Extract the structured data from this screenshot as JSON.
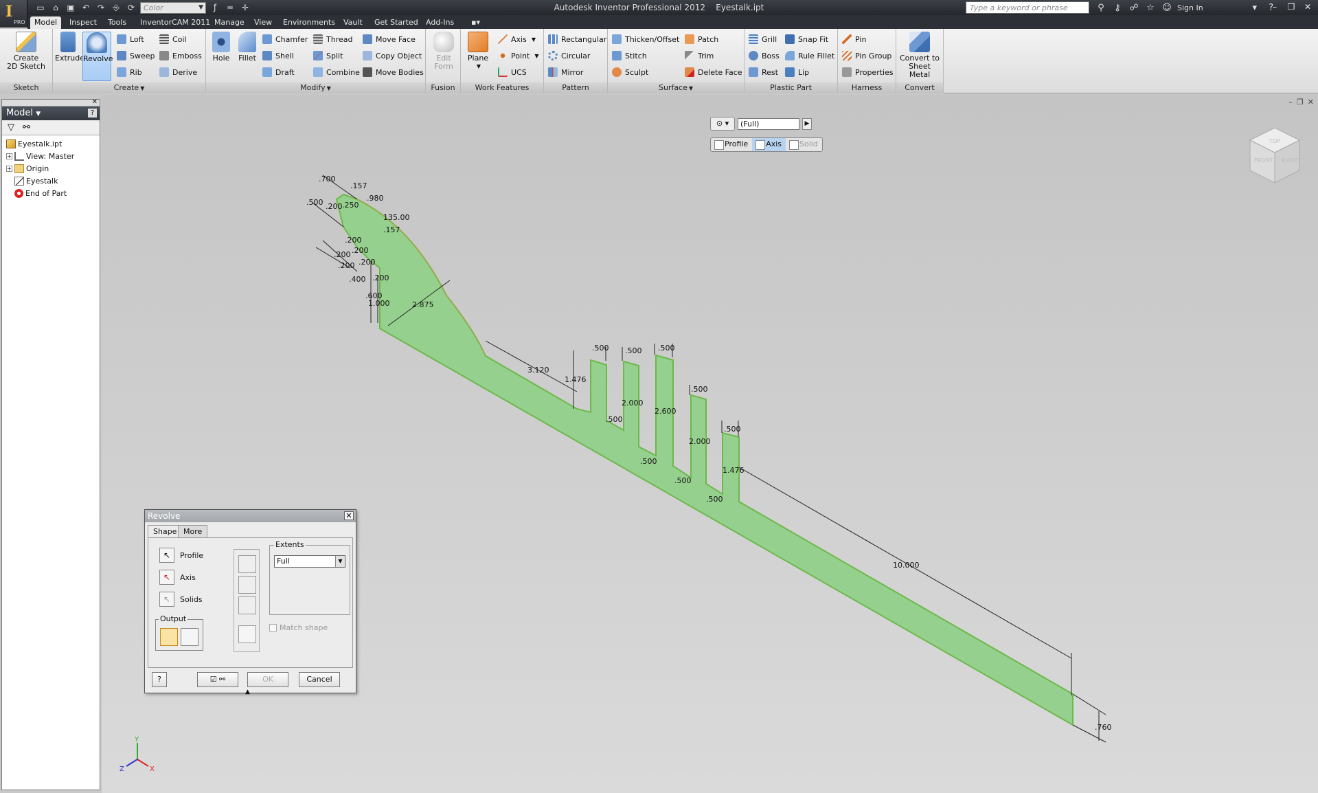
{
  "app": {
    "title": "Autodesk Inventor Professional 2012",
    "file": "Eyestalk.ipt",
    "logo_text": "I",
    "edition": "PRO",
    "color_combo": "Color",
    "search_placeholder": "Type a keyword or phrase",
    "sign_in": "Sign In"
  },
  "menu_tabs": [
    "Model",
    "Inspect",
    "Tools",
    "InventorCAM 2011",
    "Manage",
    "View",
    "Environments",
    "Vault",
    "Get Started",
    "Add-Ins"
  ],
  "ribbon": {
    "sketch": {
      "title": "Sketch",
      "create_sketch_l1": "Create",
      "create_sketch_l2": "2D Sketch"
    },
    "create": {
      "title": "Create",
      "extrude": "Extrude",
      "revolve": "Revolve",
      "loft": "Loft",
      "sweep": "Sweep",
      "rib": "Rib",
      "coil": "Coil",
      "emboss": "Emboss",
      "derive": "Derive"
    },
    "modify": {
      "title": "Modify",
      "hole": "Hole",
      "fillet": "Fillet",
      "chamfer": "Chamfer",
      "shell": "Shell",
      "draft": "Draft",
      "thread": "Thread",
      "split": "Split",
      "combine": "Combine",
      "move_face": "Move Face",
      "copy_object": "Copy Object",
      "move_bodies": "Move Bodies"
    },
    "fusion": {
      "title": "Fusion",
      "edit_form_l1": "Edit",
      "edit_form_l2": "Form"
    },
    "work_features": {
      "title": "Work Features",
      "plane": "Plane",
      "axis": "Axis",
      "point": "Point",
      "ucs": "UCS"
    },
    "pattern": {
      "title": "Pattern",
      "rectangular": "Rectangular",
      "circular": "Circular",
      "mirror": "Mirror"
    },
    "surface": {
      "title": "Surface",
      "thicken": "Thicken/Offset",
      "stitch": "Stitch",
      "sculpt": "Sculpt",
      "patch": "Patch",
      "trim": "Trim",
      "delete_face": "Delete Face"
    },
    "plastic_part": {
      "title": "Plastic Part",
      "grill": "Grill",
      "boss": "Boss",
      "rest": "Rest",
      "snap_fit": "Snap Fit",
      "rule_fillet": "Rule Fillet",
      "lip": "Lip"
    },
    "harness": {
      "title": "Harness",
      "pin": "Pin",
      "pin_group": "Pin Group",
      "properties": "Properties"
    },
    "convert": {
      "title": "Convert",
      "sheet_metal_l1": "Convert to",
      "sheet_metal_l2": "Sheet Metal"
    }
  },
  "browser": {
    "title": "Model",
    "help": "?",
    "tree": [
      {
        "label": "Eyestalk.ipt"
      },
      {
        "label": "View: Master"
      },
      {
        "label": "Origin"
      },
      {
        "label": "Eyestalk"
      },
      {
        "label": "End of Part"
      }
    ]
  },
  "minitoolbar": {
    "extent": "(Full)",
    "profile": "Profile",
    "axis": "Axis",
    "solid": "Solid"
  },
  "viewcube": {
    "top": "TOP",
    "front": "FRONT",
    "right": "RIGHT"
  },
  "triad": {
    "x": "X",
    "y": "Y",
    "z": "Z"
  },
  "dialog": {
    "title": "Revolve",
    "tab_shape": "Shape",
    "tab_more": "More",
    "profile": "Profile",
    "axis": "Axis",
    "solids": "Solids",
    "output": "Output",
    "extents": "Extents",
    "extents_value": "Full",
    "match_shape": "Match shape",
    "ok": "OK",
    "cancel": "Cancel",
    "help": "?"
  },
  "dimensions": [
    ".700",
    ".157",
    ".500",
    ".200",
    ".250",
    ".980",
    "135.00",
    ".157",
    ".200",
    ".200",
    ".200",
    ".200",
    ".200",
    ".400",
    ".600",
    "1.000",
    ".200",
    "2.875",
    "3.120",
    "1.476",
    ".500",
    ".500",
    ".500",
    ".500",
    "2.000",
    "2.600",
    ".500",
    ".500",
    "2.000",
    ".500",
    ".500",
    "1.476",
    ".500",
    "10.000",
    ".760"
  ],
  "colors": {
    "sketch_fill": "#96d08e",
    "sketch_edge": "#6cb84a",
    "ribbon_active": "#a9cdf5"
  }
}
